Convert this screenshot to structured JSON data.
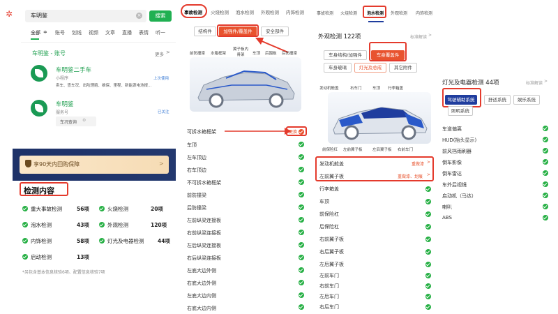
{
  "search": {
    "value": "车明鉴",
    "button": "搜索"
  },
  "filter_tabs": [
    "全部",
    "账号",
    "划线",
    "视频",
    "文章",
    "直播",
    "表情",
    "听一"
  ],
  "account_section": {
    "title": "车明鉴 - 账号",
    "more": "更多"
  },
  "account1": {
    "name": "车明鉴二手车",
    "type": "小程序",
    "tag": "上次使用",
    "desc": "卖车、查车况、出险理赔、维保、里程、新能源电池报..."
  },
  "account2": {
    "name": "车明鉴",
    "type": "服务号",
    "tag": "已关注",
    "sub": "车况查询"
  },
  "guarantee": {
    "text": "享90天内回购保障",
    "arrow": ">"
  },
  "inspect": {
    "title": "检测内容",
    "items": [
      {
        "name": "重大事故检测",
        "count": "56项"
      },
      {
        "name": "火烧检测",
        "count": "20项"
      },
      {
        "name": "泡水检测",
        "count": "43项"
      },
      {
        "name": "外观检测",
        "count": "120项"
      },
      {
        "name": "内饰检测",
        "count": "58项"
      },
      {
        "name": "灯光及电器检测",
        "count": "44项"
      },
      {
        "name": "启动检测",
        "count": "13项"
      }
    ],
    "note": "*另包含基本信息核验6项、配置信息核验7项"
  },
  "panel2": {
    "tabs": [
      "事故检测",
      "火烧检测",
      "泡水检测",
      "外观检测",
      "内饰检测"
    ],
    "pills": [
      "结构件",
      "加强件/覆盖件",
      "安全部件"
    ],
    "car_labels": [
      "前防撞梁",
      "水箱框架",
      "翼子板内骨架",
      "车顶",
      "后围板",
      "后防撞梁"
    ],
    "rows": [
      "可拆水箱框架",
      "车顶",
      "左车顶边",
      "右车顶边",
      "不可拆水箱框架",
      "前防撞梁",
      "后防撞梁",
      "左前纵梁连接板",
      "右前纵梁连接板",
      "左后纵梁连接板",
      "右后纵梁连接板",
      "左底大边外侧",
      "右底大边外侧",
      "左底大边内侧",
      "右底大边内侧"
    ],
    "first_row_tag": "更换"
  },
  "panel3": {
    "tabs": [
      "事故检测",
      "火烧检测",
      "泡水检测",
      "外观检测",
      "内饰检测"
    ],
    "title": "外观检测 122项",
    "std": "标准解读",
    "pills": [
      "车身结构/加强件",
      "车身覆盖件",
      "车身玻璃",
      "灯光及总成",
      "其它附件"
    ],
    "car_labels": [
      "发动机舱盖",
      "右车门",
      "车顶",
      "行李箱盖",
      "前保险杠",
      "左前翼子板",
      "左后翼子板",
      "右前车门"
    ],
    "highlight_rows": [
      {
        "name": "发动机舱盖",
        "tag": "重做漆"
      },
      {
        "name": "左前翼子板",
        "tag": "重做漆、划痕"
      }
    ],
    "rows": [
      "行李箱盖",
      "车顶",
      "前保险杠",
      "后保险杠",
      "右前翼子板",
      "右后翼子板",
      "左后翼子板",
      "左前车门",
      "右前车门",
      "左后车门",
      "右后车门"
    ]
  },
  "panel4": {
    "title": "灯光及电器检测 44项",
    "std": "标准解读",
    "pills": [
      "驾驶辅助系统",
      "舒适系统",
      "娱乐系统",
      "照明系统"
    ],
    "rows": [
      "车道偏离",
      "HUD(抬头显示)",
      "前风挡雨刷器",
      "倒车影像",
      "倒车雷达",
      "车外后视镜",
      "启动机（马达）",
      "喇叭",
      "ABS"
    ]
  },
  "colors": {
    "accent": "#e43a2c",
    "green": "#27b045",
    "orange": "#e8532e",
    "navy": "#1f3d9e"
  }
}
